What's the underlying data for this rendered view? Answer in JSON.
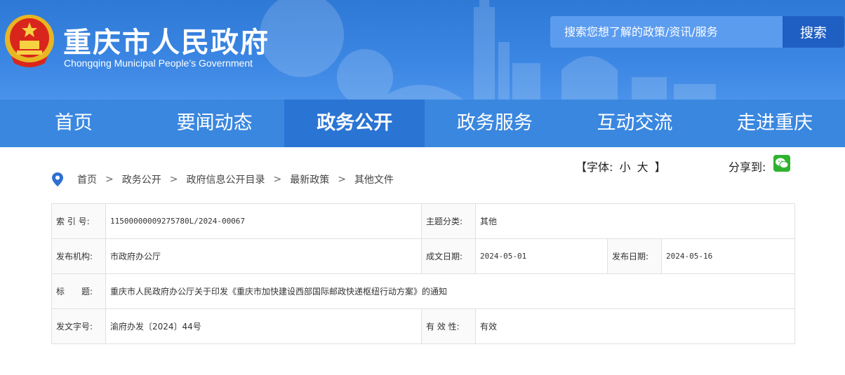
{
  "header": {
    "title": "重庆市人民政府",
    "subtitle": "Chongqing Municipal People’s Government",
    "emblem_icon": "national-emblem-icon"
  },
  "search": {
    "placeholder": "搜索您想了解的政策/资讯/服务",
    "button_label": "搜索"
  },
  "nav": {
    "items": [
      {
        "label": "首页"
      },
      {
        "label": "要闻动态"
      },
      {
        "label": "政务公开"
      },
      {
        "label": "政务服务"
      },
      {
        "label": "互动交流"
      },
      {
        "label": "走进重庆"
      }
    ],
    "active_index": 2
  },
  "tools": {
    "font_prefix": "【字体:",
    "font_small": "小",
    "font_large": "大",
    "font_suffix": "】",
    "share_label": "分享到:",
    "share_icon": "wechat-icon"
  },
  "breadcrumb": {
    "icon": "location-pin-icon",
    "items": [
      "首页",
      "政务公开",
      "政府信息公开目录",
      "最新政策",
      "其他文件"
    ],
    "separator": ">"
  },
  "doc_info": {
    "index_label": "索 引 号:",
    "index_value": "11500000009275780L/2024-00067",
    "topic_label": "主题分类:",
    "topic_value": "其他",
    "issuer_label": "发布机构:",
    "issuer_value": "市政府办公厅",
    "created_label": "成文日期:",
    "created_value": "2024-05-01",
    "published_label": "发布日期:",
    "published_value": "2024-05-16",
    "title_label": "标　　题:",
    "title_value": "重庆市人民政府办公厅关于印发《重庆市加快建设西部国际邮政快递枢纽行动方案》的通知",
    "docno_label": "发文字号:",
    "docno_value": "渝府办发〔2024〕44号",
    "validity_label": "有 效 性:",
    "validity_value": "有效"
  },
  "colors": {
    "header_blue": "#3b86e3",
    "nav_blue": "#3a87e0",
    "nav_active": "#2a74d3",
    "search_button": "#1f5fc4",
    "wechat_green": "#2fb32f"
  }
}
